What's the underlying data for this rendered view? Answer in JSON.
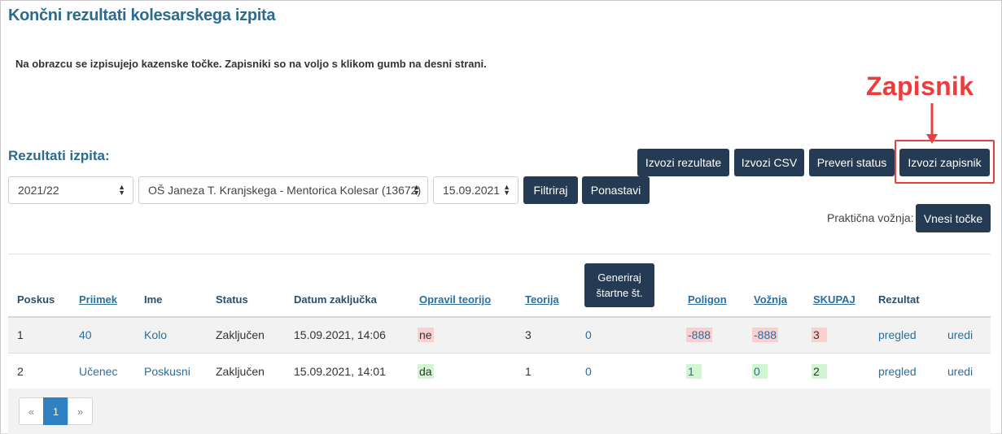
{
  "page": {
    "title": "Končni rezultati kolesarskega izpita",
    "intro": "Na obrazcu se izpisujejo kazenske točke. Zapisniki so na voljo s klikom gumb na desni strani."
  },
  "results": {
    "section_title": "Rezultati izpita:"
  },
  "actions": {
    "export_results": "Izvozi rezultate",
    "export_csv": "Izvozi CSV",
    "check_status": "Preveri status",
    "export_record": "Izvozi zapisnik"
  },
  "annotation": {
    "label": "Zapisnik",
    "color": "#ee3b3b"
  },
  "filters": {
    "year": "2021/22",
    "school": "OŠ Janeza T. Kranjskega - Mentorica Kolesar (13672)",
    "date": "15.09.2021",
    "filter_button": "Filtriraj",
    "reset_button": "Ponastavi"
  },
  "practical": {
    "label": "Praktična vožnja:",
    "button": "Vnesi točke"
  },
  "table": {
    "headers": {
      "poskus": "Poskus",
      "priimek": "Priimek",
      "ime": "Ime",
      "status": "Status",
      "datum": "Datum zaključka",
      "opravil": "Opravil teorijo",
      "teorija": "Teorija",
      "generate": "Generiraj štartne št.",
      "poligon": "Poligon",
      "voznja": "Vožnja",
      "skupaj": "SKUPAJ",
      "rezultat": "Rezultat"
    },
    "rows": [
      {
        "poskus": "1",
        "priimek": "40",
        "ime": "Kolo",
        "status": "Zaključen",
        "datum": "15.09.2021, 14:06",
        "opravil": "ne",
        "teorija": "3",
        "startna": "0",
        "poligon": "-888",
        "voznja": "-888",
        "skupaj": "3",
        "rezultat": "pregled",
        "edit": "uredi"
      },
      {
        "poskus": "2",
        "priimek": "Učenec",
        "ime": "Poskusni",
        "status": "Zaključen",
        "datum": "15.09.2021, 14:01",
        "opravil": "da",
        "teorija": "1",
        "startna": "0",
        "poligon": "1",
        "voznja": "0",
        "skupaj": "2",
        "rezultat": "pregled",
        "edit": "uredi"
      }
    ]
  },
  "pagination": {
    "prev": "«",
    "current": "1",
    "next": "»"
  },
  "colors": {
    "primary_button": "#243b53",
    "heading": "#2b6b8d",
    "link": "#2c6e9c",
    "negative_highlight": "#f9cfcf",
    "positive_highlight": "#d2f5d2",
    "pager_active": "#2e80c0"
  }
}
